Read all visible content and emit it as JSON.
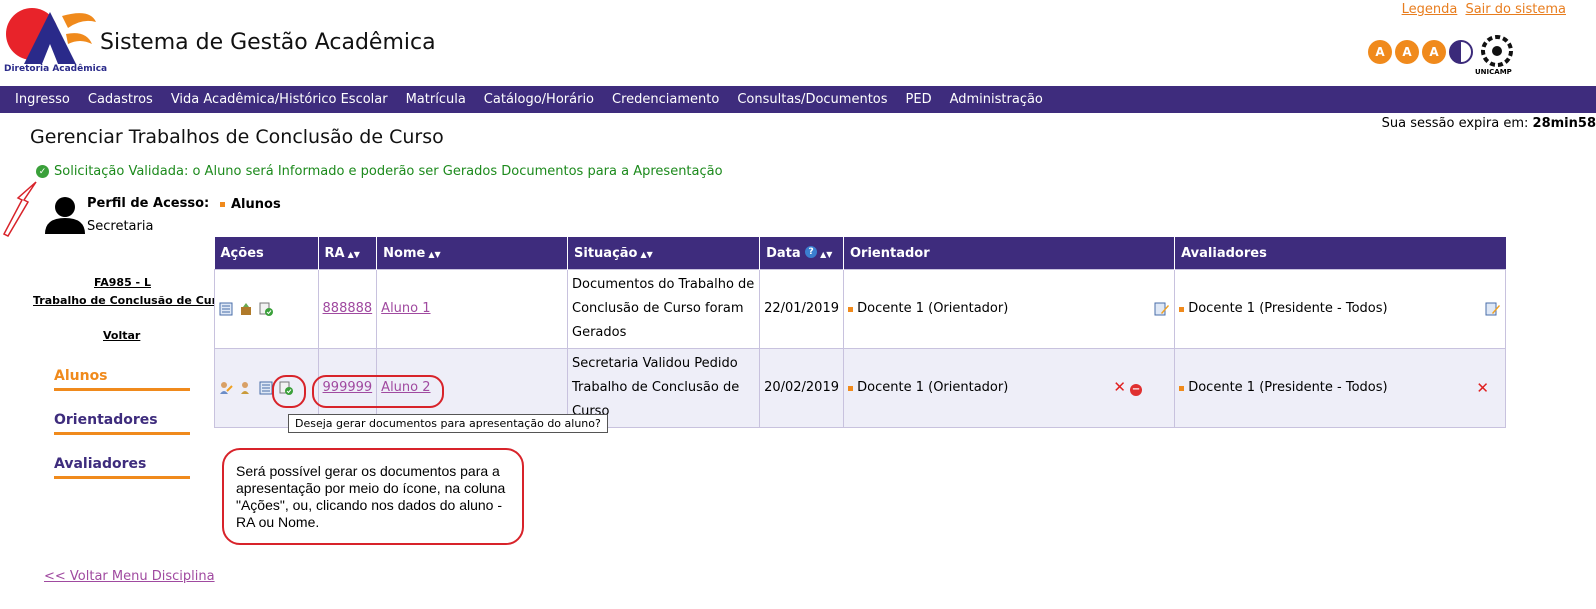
{
  "header": {
    "logo_caption": "Diretoria Acadêmica",
    "app_title": "Sistema de Gestão Acadêmica",
    "links": {
      "legend": "Legenda",
      "logout": "Sair do sistema"
    },
    "font_buttons": [
      "A",
      "A",
      "A"
    ],
    "unicamp_label": "UNICAMP"
  },
  "nav": [
    "Ingresso",
    "Cadastros",
    "Vida Acadêmica/Histórico Escolar",
    "Matrícula",
    "Catálogo/Horário",
    "Credenciamento",
    "Consultas/Documentos",
    "PED",
    "Administração"
  ],
  "session": {
    "label": "Sua sessão expira em:",
    "time": "28min58"
  },
  "page_title": "Gerenciar Trabalhos de Conclusão de Curso",
  "success_message": "Solicitação Validada: o Aluno será Informado e poderão ser Gerados Documentos para a Apresentação",
  "profile": {
    "label": "Perfil de Acesso:",
    "value": "Secretaria"
  },
  "discipline": {
    "code": "FA985 - L",
    "name": "Trabalho de Conclusão de Curso",
    "back": "Voltar"
  },
  "sidebar": [
    "Alunos",
    "Orientadores",
    "Avaliadores"
  ],
  "section_label": "Alunos",
  "table": {
    "headers": {
      "acoes": "Ações",
      "ra": "RA",
      "nome": "Nome",
      "situacao": "Situação",
      "data": "Data",
      "orientador": "Orientador",
      "avaliadores": "Avaliadores"
    },
    "rows": [
      {
        "ra": "888888",
        "nome": "Aluno 1",
        "situacao": "Documentos do Trabalho de Conclusão de Curso foram Gerados",
        "data": "22/01/2019",
        "orientador": "Docente 1 (Orientador)",
        "avaliadores": "Docente 1 (Presidente - Todos)"
      },
      {
        "ra": "999999",
        "nome": "Aluno 2",
        "situacao": "Secretaria Validou Pedido Trabalho de Conclusão de Curso",
        "data": "20/02/2019",
        "orientador": "Docente 1 (Orientador)",
        "avaliadores": "Docente 1 (Presidente - Todos)"
      }
    ]
  },
  "tooltip": "Deseja gerar documentos para apresentação do aluno?",
  "callout": "Será possível gerar os documentos para a apresentação por meio do ícone, na coluna \"Ações\", ou, clicando nos dados do aluno - RA ou Nome.",
  "back_menu": "<< Voltar Menu Disciplina",
  "colors": {
    "nav_bg": "#3e2c7d",
    "accent": "#f08a1c",
    "success": "#1c8a1c",
    "link": "#a04aa0",
    "annotation": "#d8232a"
  }
}
